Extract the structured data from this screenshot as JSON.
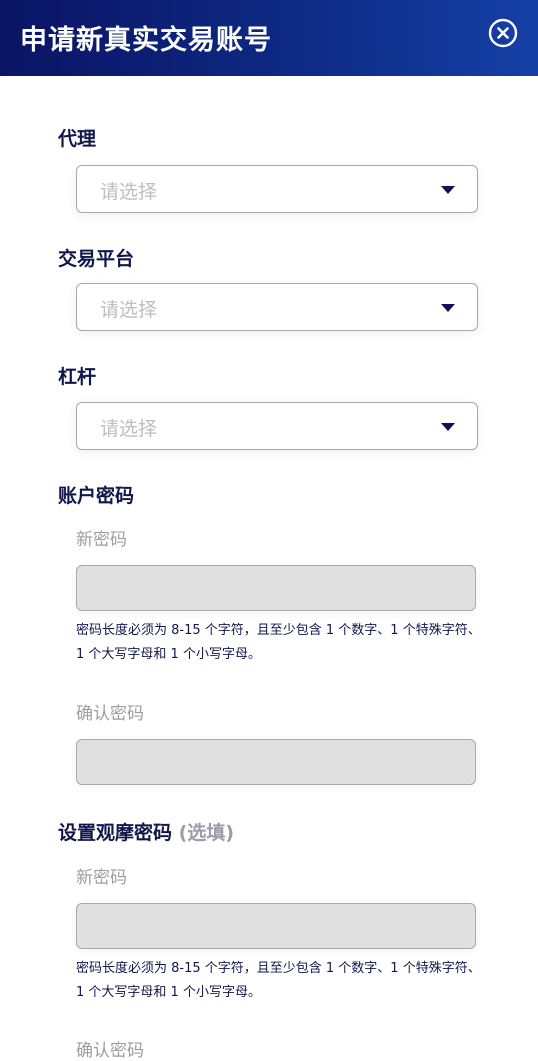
{
  "header": {
    "title": "申请新真实交易账号",
    "close_icon": "close-circle-icon"
  },
  "agent": {
    "label": "代理",
    "placeholder": "请选择"
  },
  "platform": {
    "label": "交易平台",
    "placeholder": "请选择"
  },
  "leverage": {
    "label": "杠杆",
    "placeholder": "请选择"
  },
  "account_password": {
    "label": "账户密码",
    "new_label": "新密码",
    "hint": "密码长度必须为 8-15 个字符，且至少包含 1 个数字、1 个特殊字符、1 个大写字母和 1 个小写字母。",
    "confirm_label": "确认密码"
  },
  "investor_password": {
    "label": "设置观摩密码",
    "optional": "(选填)",
    "new_label": "新密码",
    "hint": "密码长度必须为 8-15 个字符，且至少包含 1 个数字、1 个特殊字符、1 个大写字母和 1 个小写字母。",
    "confirm_label": "确认密码"
  },
  "colors": {
    "header_start": "#0a1464",
    "header_end": "#1440a6",
    "label": "#11174a",
    "input_fill": "#e0e0e0"
  }
}
